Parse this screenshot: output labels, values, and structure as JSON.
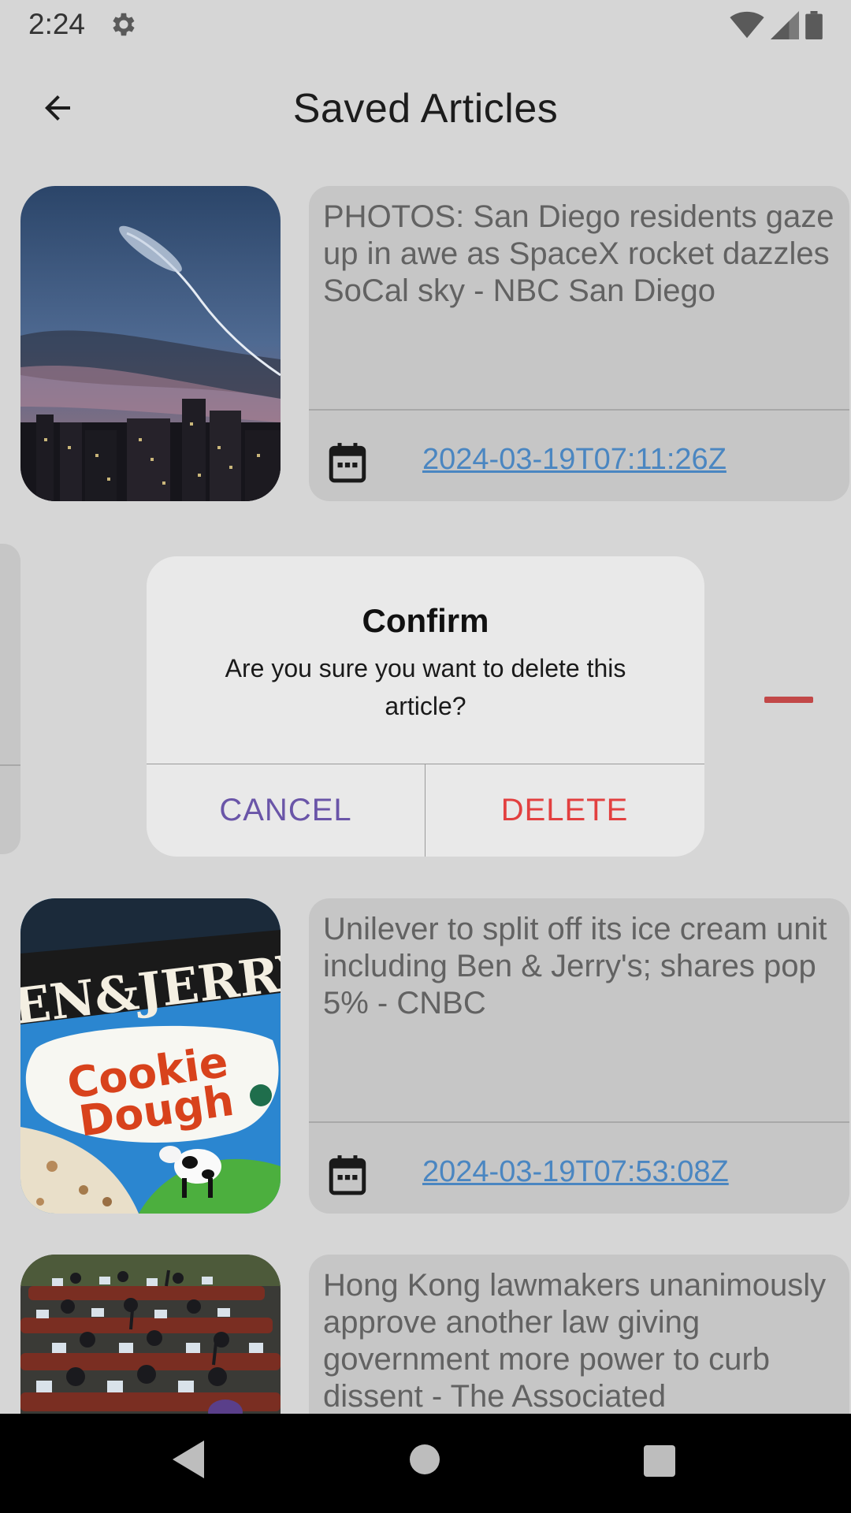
{
  "status_bar": {
    "time": "2:24",
    "icons": [
      "gear-icon",
      "wifi-icon",
      "signal-icon",
      "battery-icon"
    ]
  },
  "app_bar": {
    "title": "Saved Articles",
    "back_icon": "arrow-back-icon"
  },
  "articles": [
    {
      "headline": "PHOTOS: San Diego residents gaze up in awe as SpaceX rocket dazzles SoCal sky - NBC San Diego",
      "date": "2024-03-19T07:11:26Z",
      "image": "rocket-trail-night-sky-city-photo"
    },
    {
      "headline": "Unilever to split off its ice cream unit including Ben & Jerry's; shares pop 5% - CNBC",
      "date": "2024-03-19T07:53:08Z",
      "image": "ben-and-jerrys-cookie-dough-pint-photo"
    },
    {
      "headline": "Hong Kong lawmakers unanimously approve another law giving government more power to curb dissent - The Associated",
      "date": "",
      "image": "legislative-chamber-vote-photo"
    }
  ],
  "dialog": {
    "title": "Confirm",
    "message": "Are you sure you want to delete this article?",
    "cancel_label": "CANCEL",
    "delete_label": "DELETE"
  },
  "colors": {
    "date_link": "#4a86c1",
    "cancel": "#6a55a8",
    "delete": "#e24040",
    "remove_dash": "#c24848"
  },
  "nav_bar": {
    "icons": [
      "nav-back-icon",
      "nav-home-icon",
      "nav-recent-icon"
    ]
  }
}
